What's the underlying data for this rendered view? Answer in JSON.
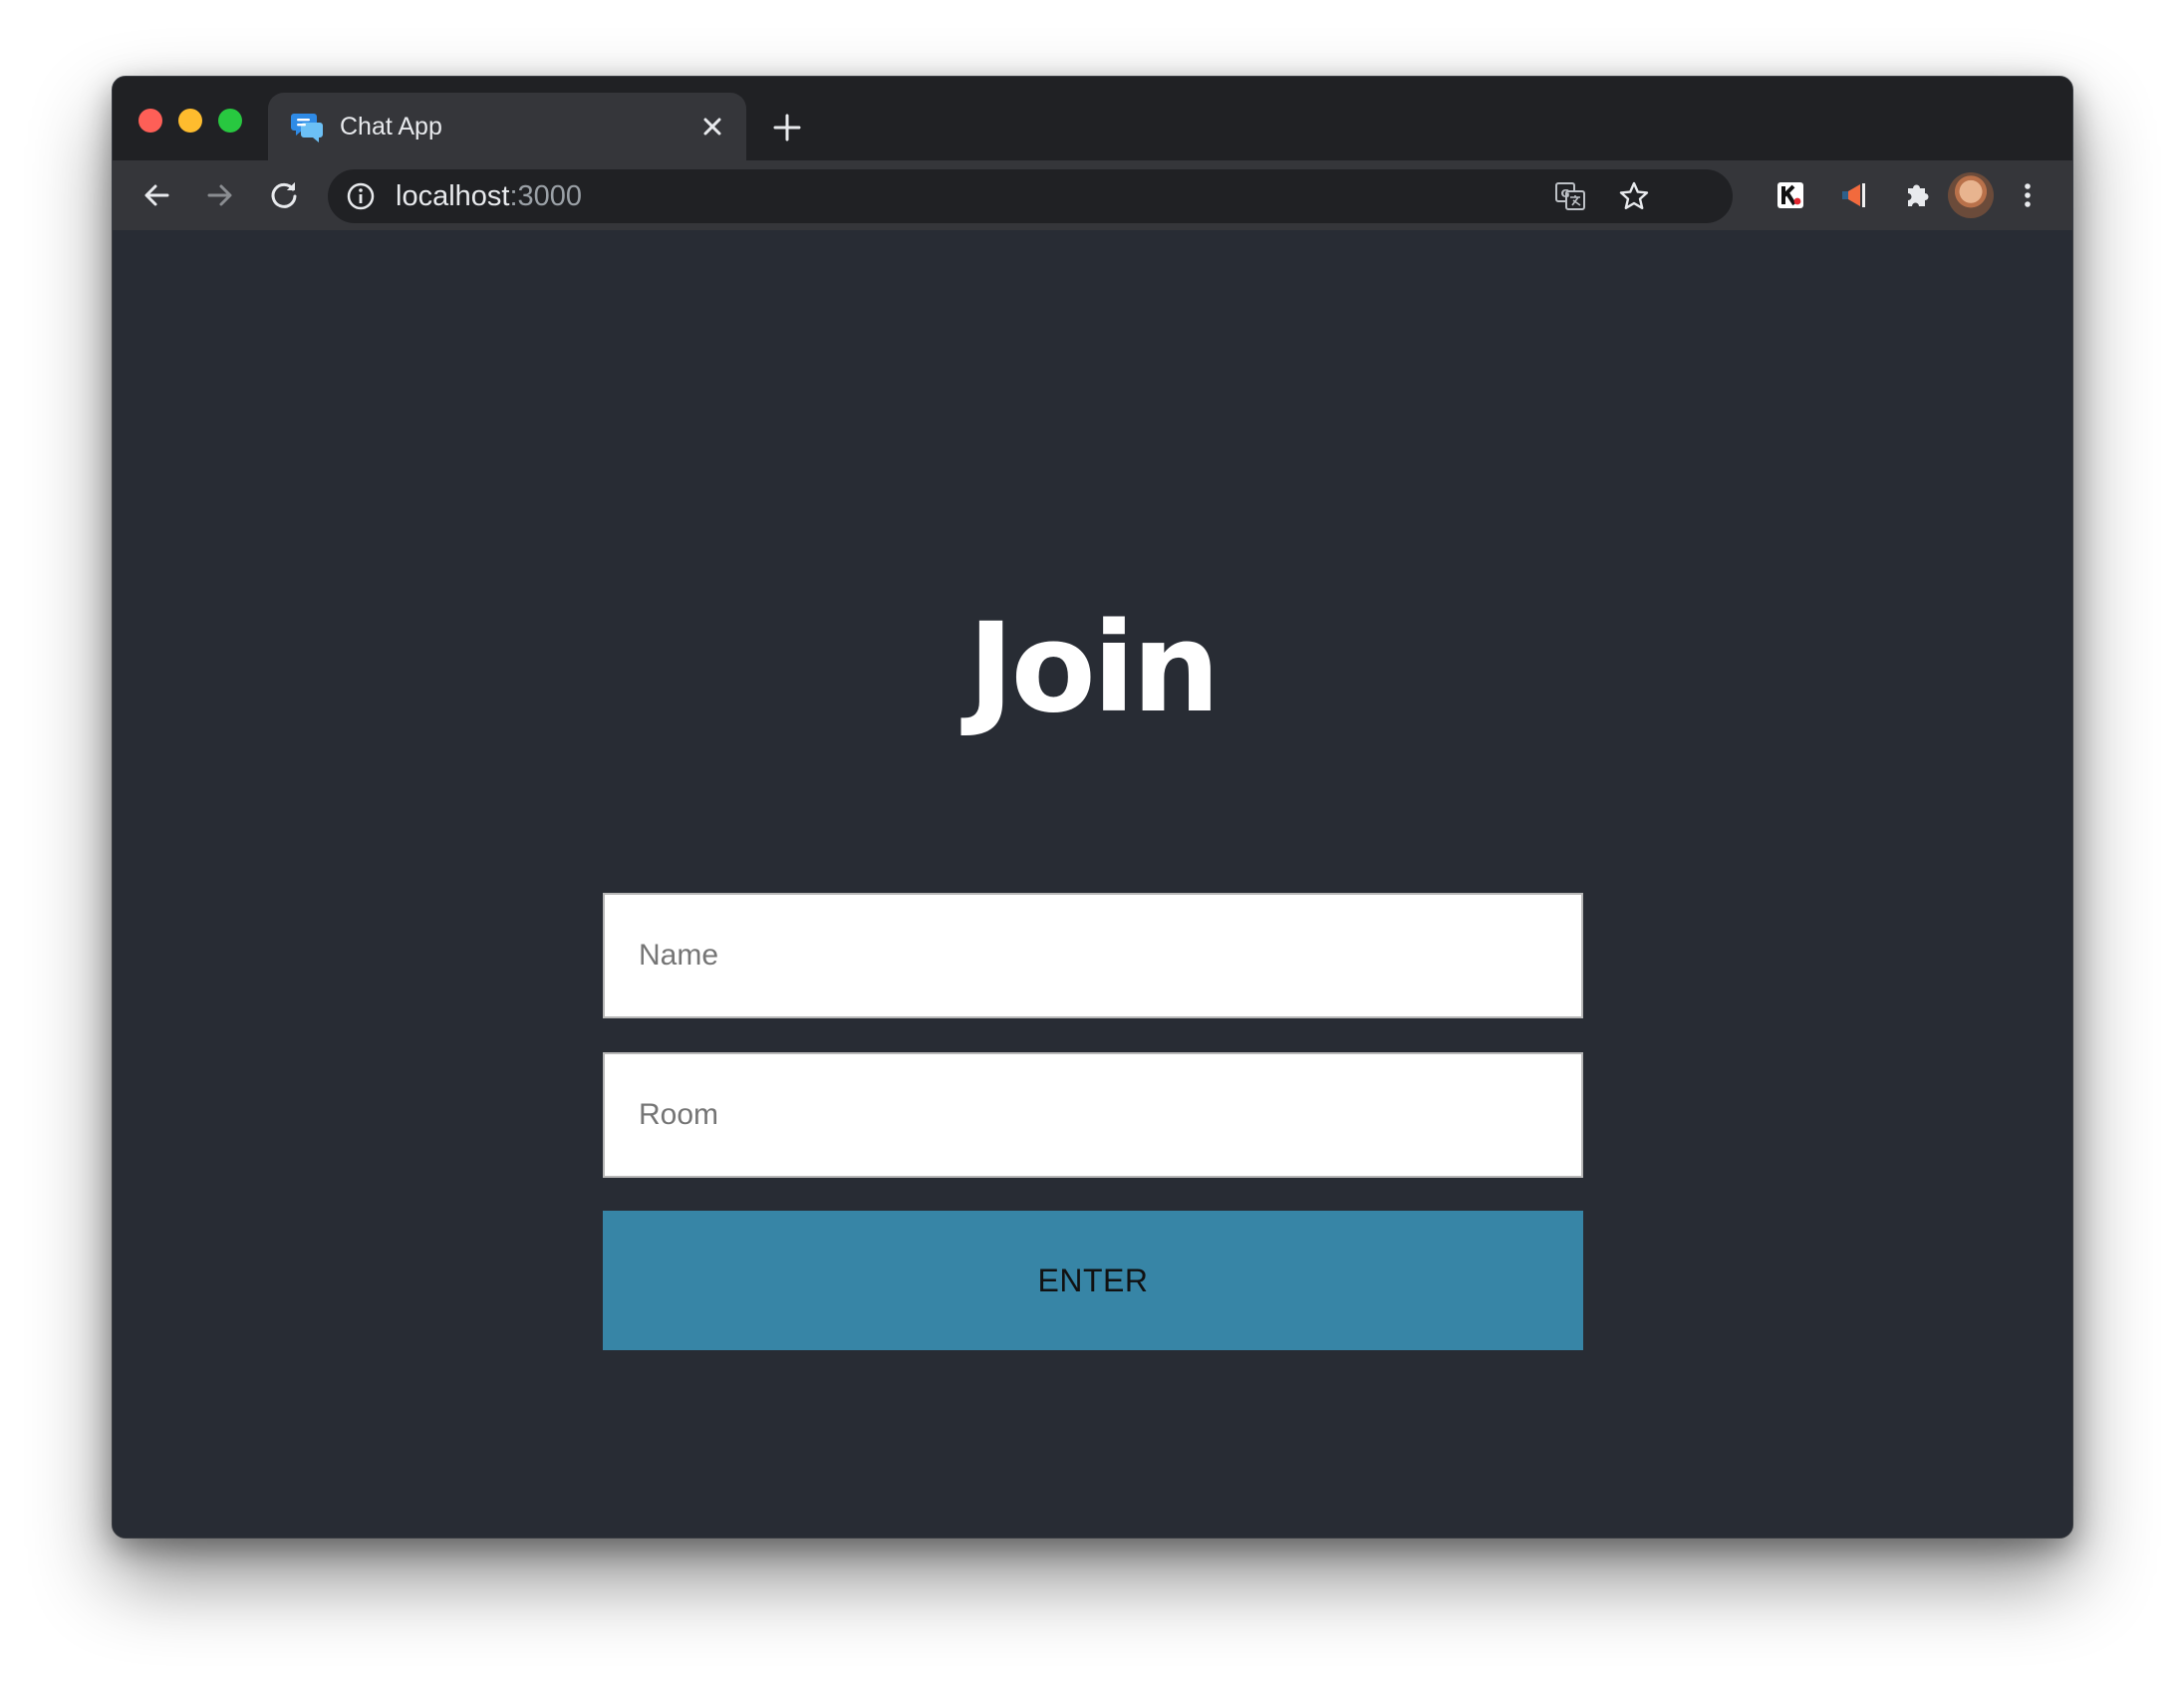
{
  "browser": {
    "tab": {
      "title": "Chat App",
      "icon": "chat-bubbles-icon"
    },
    "toolbar": {
      "url_host": "localhost",
      "url_port": ":3000",
      "extensions": [
        "translate-icon",
        "bookmark-star-icon",
        "k-extension-icon",
        "megaphone-extension-icon",
        "puzzle-extensions-icon",
        "profile-avatar",
        "more-menu-icon"
      ]
    },
    "colors": {
      "titlebar": "#202124",
      "toolbar": "#35363a",
      "page_background": "#282c34",
      "button_accent": "#3785a6"
    }
  },
  "page": {
    "heading": "Join",
    "name_placeholder": "Name",
    "room_placeholder": "Room",
    "enter_label": "ENTER"
  }
}
